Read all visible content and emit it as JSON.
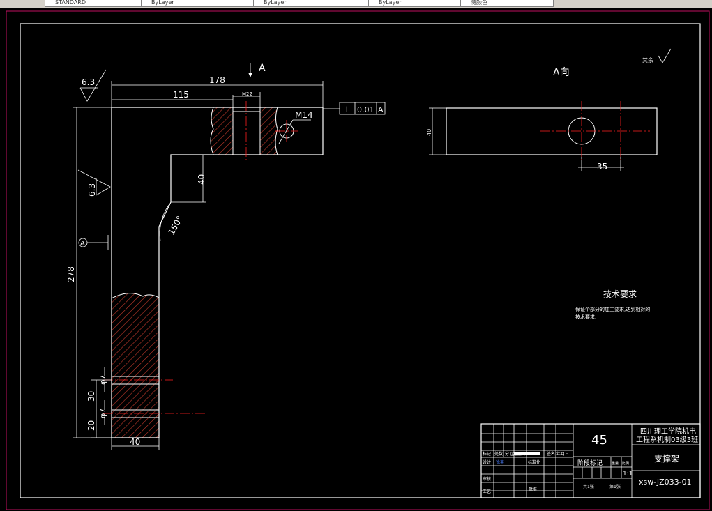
{
  "toolbar": {
    "items": [
      {
        "label": "STANDARD"
      },
      {
        "label": "ByLayer"
      },
      {
        "label": "ByLayer"
      },
      {
        "label": "ByLayer"
      },
      {
        "label": "随颜色"
      }
    ]
  },
  "colors": {
    "background": "#000000",
    "lines": "#ffffff",
    "hatch": "#c0392b",
    "center_lines": "#ff2020",
    "sheet_border": "#c01060"
  },
  "drawing": {
    "main_view": {
      "roughness_top": "6.3",
      "roughness_left": "6.3",
      "section_marker": "A",
      "dim_overall_width": "178",
      "dim_hole_offset": "115",
      "dim_bore": "M22",
      "dim_thread": "M14",
      "dim_step": "40",
      "dim_angle": "150°",
      "dim_height": "278",
      "dim_hole1": "φ7",
      "dim_hole2": "φ7",
      "dim_spacing": "30",
      "dim_bottom": "20",
      "dim_width_bottom": "40",
      "datum_label": "A",
      "tolerance_symbol": "⊥",
      "tolerance_value": "0.01",
      "tolerance_datum": "A"
    },
    "side_view": {
      "title": "A向",
      "dim_height": "40",
      "dim_width": "35"
    },
    "other_roughness": "其余",
    "tech_requirements": {
      "title": "技术要求",
      "line1": "保证个部分的加工要求,达到相对的",
      "line2": "技术要求."
    }
  },
  "title_block": {
    "material": "45",
    "school_line1": "四川理工学院机电",
    "school_line2": "工程系机制03级3班",
    "part_name": "支撑架",
    "drawing_number": "xsw-JZ033-01",
    "stage_mark": "阶段标记",
    "weight": "重量",
    "scale_label": "比例",
    "scale": "1:1",
    "total_sheets": "共1张",
    "sheet_no": "第1张",
    "hdr_mark": "标记",
    "hdr_count": "处数",
    "hdr_zone": "分 区",
    "hdr_doc": "更改文件号",
    "hdr_sign": "签名",
    "hdr_date": "年月日",
    "design": "设计",
    "designer": "徐英",
    "standardize": "标准化",
    "review": "审核",
    "craft": "工艺",
    "approve": "批准"
  }
}
